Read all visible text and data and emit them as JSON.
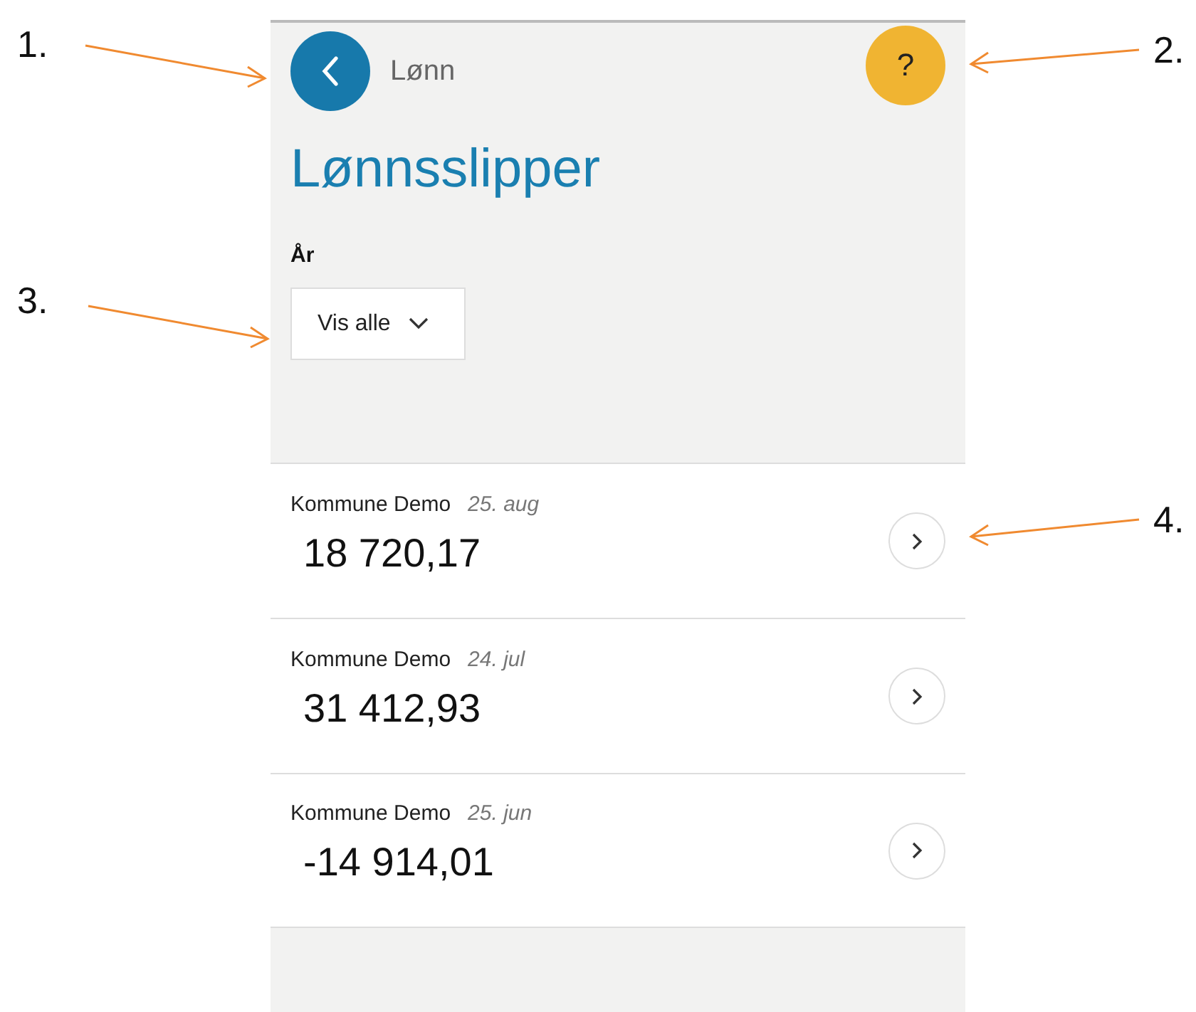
{
  "header": {
    "back_label": "Lønn",
    "help_button": "?",
    "title": "Lønnsslipper"
  },
  "filter": {
    "label": "År",
    "value": "Vis alle"
  },
  "payslips": [
    {
      "employer": "Kommune Demo",
      "date": "25. aug",
      "amount": "18 720,17"
    },
    {
      "employer": "Kommune Demo",
      "date": "24. jul",
      "amount": "31 412,93"
    },
    {
      "employer": "Kommune Demo",
      "date": "25. jun",
      "amount": "-14 914,01"
    }
  ],
  "annotations": [
    {
      "label": "1.",
      "kind": "rightward"
    },
    {
      "label": "2.",
      "kind": "leftward"
    },
    {
      "label": "3.",
      "kind": "rightward"
    },
    {
      "label": "4.",
      "kind": "leftward"
    }
  ]
}
